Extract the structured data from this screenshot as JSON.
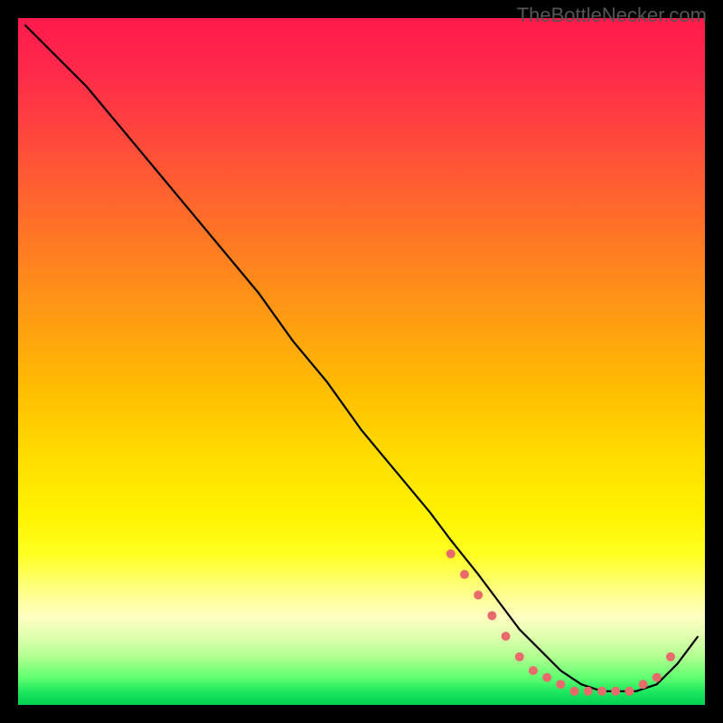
{
  "watermark": "TheBottleNecker.com",
  "chart_data": {
    "type": "line",
    "title": "",
    "xlabel": "",
    "ylabel": "",
    "xlim": [
      0,
      100
    ],
    "ylim": [
      0,
      100
    ],
    "series": [
      {
        "name": "curve",
        "x": [
          1,
          5,
          10,
          15,
          20,
          25,
          30,
          35,
          40,
          45,
          50,
          55,
          60,
          63,
          67,
          70,
          73,
          76,
          79,
          82,
          85,
          88,
          90,
          93,
          96,
          99
        ],
        "y": [
          99,
          95,
          90,
          84,
          78,
          72,
          66,
          60,
          53,
          47,
          40,
          34,
          28,
          24,
          19,
          15,
          11,
          8,
          5,
          3,
          2,
          2,
          2,
          3,
          6,
          10
        ]
      }
    ],
    "markers": {
      "name": "flat-region-dots",
      "x": [
        63,
        65,
        67,
        69,
        71,
        73,
        75,
        77,
        79,
        81,
        83,
        85,
        87,
        89,
        91,
        93,
        95
      ],
      "y": [
        22,
        19,
        16,
        13,
        10,
        7,
        5,
        4,
        3,
        2,
        2,
        2,
        2,
        2,
        3,
        4,
        7
      ],
      "color": "#e86a6a",
      "size": 5
    },
    "background_gradient": {
      "top": "#ff1a4d",
      "mid": "#ffe000",
      "bottom": "#00d050"
    }
  }
}
